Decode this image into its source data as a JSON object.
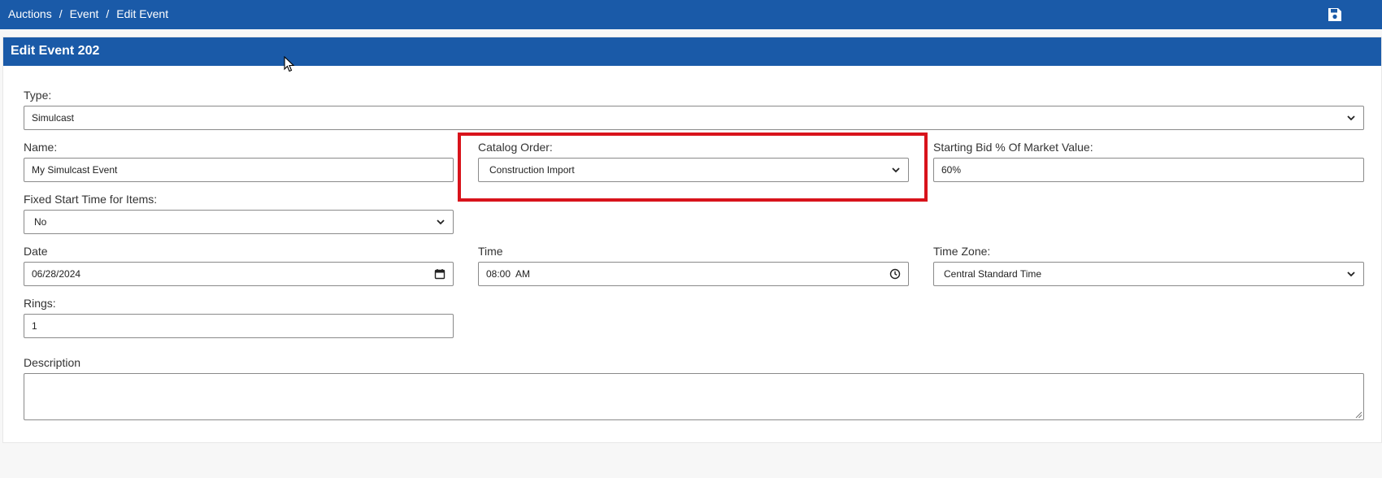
{
  "breadcrumb": {
    "items": [
      "Auctions",
      "Event",
      "Edit Event"
    ],
    "separator": "/"
  },
  "toolbar": {
    "save_icon": "save-icon"
  },
  "card": {
    "title": "Edit Event 202"
  },
  "form": {
    "type": {
      "label": "Type:",
      "value": "Simulcast"
    },
    "name": {
      "label": "Name:",
      "value": "My Simulcast Event"
    },
    "catalog_order": {
      "label": "Catalog Order:",
      "value": "Construction Import"
    },
    "starting_bid": {
      "label": "Starting Bid % Of Market Value:",
      "value": "60%"
    },
    "fixed_start": {
      "label": "Fixed Start Time for Items:",
      "value": "No"
    },
    "date": {
      "label": "Date",
      "value": "06/28/2024"
    },
    "time": {
      "label": "Time",
      "value": "08:00  AM"
    },
    "time_zone": {
      "label": "Time Zone:",
      "value": "Central Standard Time"
    },
    "rings": {
      "label": "Rings:",
      "value": "1"
    },
    "description": {
      "label": "Description",
      "value": ""
    }
  },
  "colors": {
    "header_blue": "#1a5aa8",
    "highlight_red": "#d8131b"
  }
}
